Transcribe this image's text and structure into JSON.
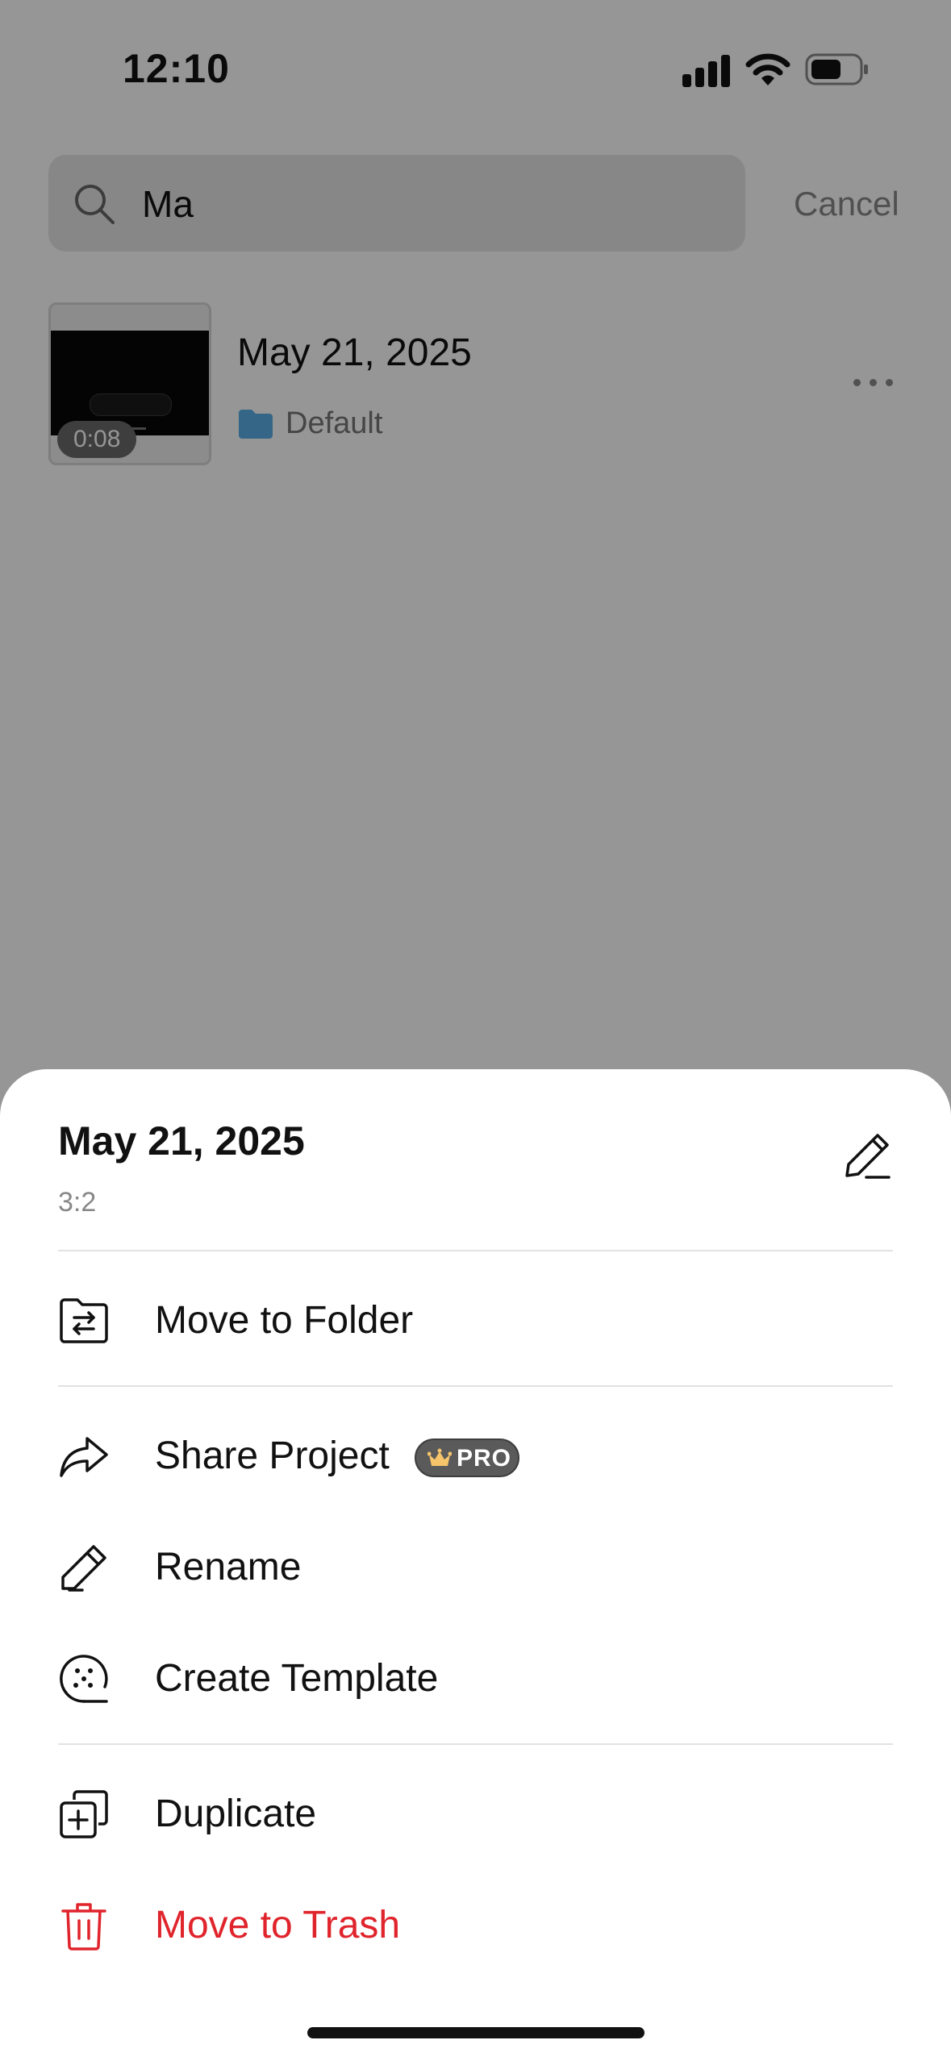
{
  "status_bar": {
    "time": "12:10"
  },
  "search": {
    "query": "Ma",
    "cancel_label": "Cancel"
  },
  "project": {
    "title": "May 21, 2025",
    "duration": "0:08",
    "folder": "Default"
  },
  "sheet": {
    "title": "May 21, 2025",
    "aspect_ratio": "3:2",
    "menu": {
      "move_to_folder": "Move to Folder",
      "share_project": "Share Project",
      "pro_badge": "PRO",
      "rename": "Rename",
      "create_template": "Create Template",
      "duplicate": "Duplicate",
      "move_to_trash": "Move to Trash"
    }
  },
  "colors": {
    "destructive": "#e0242c",
    "folder": "#5aaee8",
    "overlay": "rgba(0,0,0,0.41)"
  },
  "icons": [
    "search-icon",
    "folder-icon",
    "more-icon",
    "pencil-icon",
    "folder-move-icon",
    "share-arrow-icon",
    "crown-icon",
    "template-icon",
    "duplicate-icon",
    "trash-icon"
  ]
}
